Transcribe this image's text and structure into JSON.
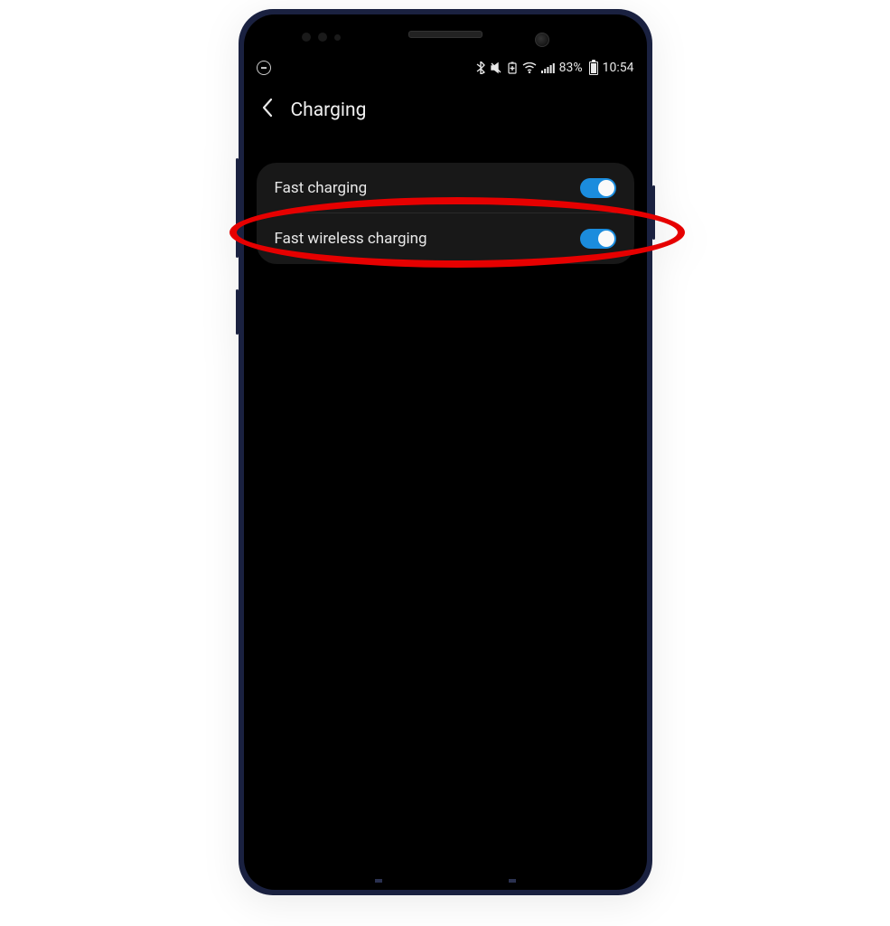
{
  "status_bar": {
    "battery_percent": "83%",
    "time": "10:54"
  },
  "header": {
    "title": "Charging"
  },
  "settings": [
    {
      "label": "Fast charging",
      "on": true
    },
    {
      "label": "Fast wireless charging",
      "on": true
    }
  ]
}
